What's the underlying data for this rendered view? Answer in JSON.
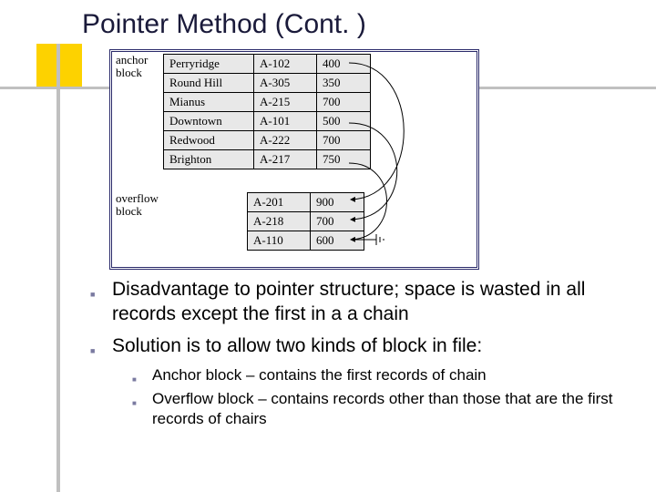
{
  "title": "Pointer Method (Cont. )",
  "figure": {
    "label_anchor": "anchor block",
    "label_overflow": "overflow block",
    "anchor_rows": [
      {
        "branch": "Perryridge",
        "acct": "A-102",
        "bal": "400"
      },
      {
        "branch": "Round Hill",
        "acct": "A-305",
        "bal": "350"
      },
      {
        "branch": "Mianus",
        "acct": "A-215",
        "bal": "700"
      },
      {
        "branch": "Downtown",
        "acct": "A-101",
        "bal": "500"
      },
      {
        "branch": "Redwood",
        "acct": "A-222",
        "bal": "700"
      },
      {
        "branch": "Brighton",
        "acct": "A-217",
        "bal": "750"
      }
    ],
    "overflow_rows": [
      {
        "acct": "A-201",
        "bal": "900"
      },
      {
        "acct": "A-218",
        "bal": "700"
      },
      {
        "acct": "A-110",
        "bal": "600"
      }
    ]
  },
  "bullets": {
    "b1": "Disadvantage to pointer structure; space is wasted in all records except the first in a a chain",
    "b2": "Solution is to allow two kinds of block in file:",
    "s1": "Anchor block – contains the first records of chain",
    "s2": "Overflow block – contains records other than those that are the first records of chairs"
  }
}
